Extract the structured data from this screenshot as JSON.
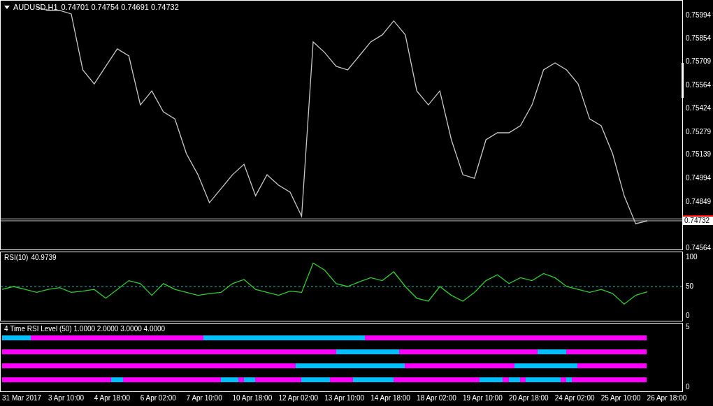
{
  "price_panel": {
    "symbol": "AUDUSD,H1",
    "quote": "0.74701 0.74754 0.74691 0.74732",
    "bid_label": "0.74732",
    "chart_data": {
      "type": "line",
      "ylim": [
        0.74556,
        0.76084
      ],
      "categories": [
        null,
        null,
        null,
        null,
        null,
        null,
        null,
        null,
        null,
        null,
        null,
        null,
        null,
        null,
        null,
        null,
        null,
        null,
        null,
        null,
        null,
        null,
        null,
        null,
        null,
        null,
        null,
        null,
        null,
        null,
        null,
        null,
        null,
        null,
        null,
        null,
        null,
        null,
        null,
        null,
        null,
        null,
        null,
        null,
        null,
        null,
        null,
        null,
        null,
        null,
        null,
        null,
        null,
        null,
        null,
        null,
        null
      ],
      "series": [
        {
          "color": "#c8c8c8",
          "values": [
            null,
            null,
            null,
            0.76045,
            0.76024,
            0.76024,
            0.76003,
            0.75659,
            0.75573,
            0.75681,
            0.75788,
            0.75745,
            0.75444,
            0.7553,
            0.75401,
            0.75358,
            0.75144,
            0.75015,
            0.74843,
            0.74929,
            0.75015,
            0.75079,
            0.74886,
            0.75015,
            0.74951,
            0.74908,
            0.7476,
            0.75831,
            0.75766,
            0.75681,
            0.75659,
            0.75745,
            0.75831,
            0.75874,
            0.7596,
            0.75874,
            0.7553,
            0.75444,
            0.7553,
            0.7523,
            0.75015,
            0.74993,
            0.7523,
            0.75273,
            0.75273,
            0.75316,
            0.75444,
            0.75659,
            0.75702,
            0.75659,
            0.75573,
            0.75358,
            0.75316,
            0.75144,
            0.74886,
            0.74714,
            0.74732
          ]
        }
      ],
      "yticks": [
        {
          "value": 0.75994,
          "label": "0.75994"
        },
        {
          "value": 0.75854,
          "label": "0.75854"
        },
        {
          "value": 0.75709,
          "label": "0.75709"
        },
        {
          "value": 0.75564,
          "label": "0.75564"
        },
        {
          "value": 0.75424,
          "label": "0.75424"
        },
        {
          "value": 0.75279,
          "label": "0.75279"
        },
        {
          "value": 0.75139,
          "label": "0.75139"
        },
        {
          "value": 0.74994,
          "label": "0.74994"
        },
        {
          "value": 0.74849,
          "label": "0.74849"
        },
        {
          "value": 0.74564,
          "label": "0.74564"
        }
      ],
      "ref_lines": [
        {
          "axis": "y",
          "value": 0.74744,
          "color": "#c0c0c0"
        },
        {
          "axis": "y",
          "value": 0.74732,
          "color": "#c0c0c0"
        }
      ]
    }
  },
  "rsi_panel": {
    "title": "RSI(10)",
    "reading": "40.9739",
    "chart_data": {
      "type": "line",
      "ylim": [
        -8.3,
        108.3
      ],
      "categories": [
        null,
        null,
        null,
        null,
        null,
        null,
        null,
        null,
        null,
        null,
        null,
        null,
        null,
        null,
        null,
        null,
        null,
        null,
        null,
        null,
        null,
        null,
        null,
        null,
        null,
        null,
        null,
        null,
        null,
        null,
        null,
        null,
        null,
        null,
        null,
        null,
        null,
        null,
        null,
        null,
        null,
        null,
        null,
        null,
        null,
        null,
        null,
        null,
        null,
        null,
        null,
        null,
        null,
        null,
        null,
        null,
        null
      ],
      "series": [
        {
          "color": "#32cd32",
          "values": [
            45,
            50,
            45,
            40,
            45,
            48,
            40,
            42,
            45,
            30,
            45,
            60,
            55,
            35,
            55,
            45,
            40,
            35,
            38,
            40,
            55,
            62,
            45,
            40,
            35,
            42,
            40,
            90,
            78,
            55,
            50,
            58,
            65,
            60,
            75,
            50,
            30,
            25,
            50,
            35,
            25,
            40,
            60,
            70,
            55,
            65,
            60,
            72,
            65,
            50,
            45,
            40,
            45,
            38,
            20,
            35,
            41
          ]
        }
      ],
      "yticks": [
        {
          "value": 0,
          "label": "0"
        },
        {
          "value": 50,
          "label": "50"
        },
        {
          "value": 100,
          "label": "100"
        }
      ],
      "ref_lines": [
        {
          "axis": "y",
          "value": 50,
          "color": "#20b2aa"
        }
      ]
    }
  },
  "level_panel": {
    "title": "4 Time RSI Level (50) 1.0000 2.0000 3.0000 4.0000",
    "axis_labels": [
      "5",
      "0"
    ],
    "rows": [
      {
        "cells": [
          {
            "color": "#00bfff"
          },
          {
            "color": "#00bfff"
          },
          {
            "color": "#00bfff"
          },
          {
            "color": "#00bfff"
          },
          {
            "color": "#00bfff"
          },
          {
            "color": "#ff00ff"
          },
          {
            "color": "#ff00ff"
          },
          {
            "color": "#ff00ff"
          },
          {
            "color": "#ff00ff"
          },
          {
            "color": "#ff00ff"
          },
          {
            "color": "#ff00ff"
          },
          {
            "color": "#ff00ff"
          },
          {
            "color": "#ff00ff"
          },
          {
            "color": "#ff00ff"
          },
          {
            "color": "#ff00ff"
          },
          {
            "color": "#ff00ff"
          },
          {
            "color": "#ff00ff"
          },
          {
            "color": "#ff00ff"
          },
          {
            "color": "#ff00ff"
          },
          {
            "color": "#ff00ff"
          },
          {
            "color": "#ff00ff"
          },
          {
            "color": "#ff00ff"
          },
          {
            "color": "#ff00ff"
          },
          {
            "color": "#ff00ff"
          },
          {
            "color": "#ff00ff"
          },
          {
            "color": "#ff00ff"
          },
          {
            "color": "#ff00ff"
          },
          {
            "color": "#ff00ff"
          },
          {
            "color": "#ff00ff"
          },
          {
            "color": "#ff00ff"
          },
          {
            "color": "#ff00ff"
          },
          {
            "color": "#ff00ff"
          },
          {
            "color": "#ff00ff"
          },
          {
            "color": "#ff00ff"
          },
          {
            "color": "#ff00ff"
          },
          {
            "color": "#00bfff"
          },
          {
            "color": "#00bfff"
          },
          {
            "color": "#00bfff"
          },
          {
            "color": "#00bfff"
          },
          {
            "color": "#00bfff"
          },
          {
            "color": "#00bfff"
          },
          {
            "color": "#00bfff"
          },
          {
            "color": "#00bfff"
          },
          {
            "color": "#00bfff"
          },
          {
            "color": "#00bfff"
          },
          {
            "color": "#00bfff"
          },
          {
            "color": "#00bfff"
          },
          {
            "color": "#00bfff"
          },
          {
            "color": "#00bfff"
          },
          {
            "color": "#00bfff"
          },
          {
            "color": "#00bfff"
          },
          {
            "color": "#00bfff"
          },
          {
            "color": "#00bfff"
          },
          {
            "color": "#00bfff"
          },
          {
            "color": "#00bfff"
          },
          {
            "color": "#00bfff"
          },
          {
            "color": "#00bfff"
          },
          {
            "color": "#00bfff"
          },
          {
            "color": "#00bfff"
          },
          {
            "color": "#00bfff"
          },
          {
            "color": "#00bfff"
          },
          {
            "color": "#00bfff"
          },
          {
            "color": "#00bfff"
          },
          {
            "color": "#ff00ff"
          },
          {
            "color": "#ff00ff"
          },
          {
            "color": "#ff00ff"
          },
          {
            "color": "#ff00ff"
          },
          {
            "color": "#ff00ff"
          },
          {
            "color": "#ff00ff"
          },
          {
            "color": "#ff00ff"
          },
          {
            "color": "#ff00ff"
          },
          {
            "color": "#ff00ff"
          },
          {
            "color": "#ff00ff"
          },
          {
            "color": "#ff00ff"
          },
          {
            "color": "#ff00ff"
          },
          {
            "color": "#ff00ff"
          },
          {
            "color": "#ff00ff"
          },
          {
            "color": "#ff00ff"
          },
          {
            "color": "#ff00ff"
          },
          {
            "color": "#ff00ff"
          },
          {
            "color": "#ff00ff"
          },
          {
            "color": "#ff00ff"
          },
          {
            "color": "#ff00ff"
          },
          {
            "color": "#ff00ff"
          },
          {
            "color": "#ff00ff"
          },
          {
            "color": "#ff00ff"
          },
          {
            "color": "#ff00ff"
          },
          {
            "color": "#ff00ff"
          },
          {
            "color": "#ff00ff"
          },
          {
            "color": "#ff00ff"
          },
          {
            "color": "#ff00ff"
          },
          {
            "color": "#ff00ff"
          },
          {
            "color": "#ff00ff"
          },
          {
            "color": "#ff00ff"
          },
          {
            "color": "#ff00ff"
          },
          {
            "color": "#ff00ff"
          },
          {
            "color": "#ff00ff"
          },
          {
            "color": "#ff00ff"
          },
          {
            "color": "#ff00ff"
          },
          {
            "color": "#ff00ff"
          },
          {
            "color": "#ff00ff"
          },
          {
            "color": "#ff00ff"
          },
          {
            "color": "#ff00ff"
          },
          {
            "color": "#ff00ff"
          },
          {
            "color": "#ff00ff"
          },
          {
            "color": "#ff00ff"
          },
          {
            "color": "#ff00ff"
          },
          {
            "color": "#ff00ff"
          },
          {
            "color": "#ff00ff"
          },
          {
            "color": "#ff00ff"
          },
          {
            "color": "#ff00ff"
          },
          {
            "color": "#ff00ff"
          }
        ]
      },
      {
        "cells": [
          {
            "color": "#ff00ff"
          },
          {
            "color": "#ff00ff"
          },
          {
            "color": "#ff00ff"
          },
          {
            "color": "#ff00ff"
          },
          {
            "color": "#ff00ff"
          },
          {
            "color": "#ff00ff"
          },
          {
            "color": "#ff00ff"
          },
          {
            "color": "#ff00ff"
          },
          {
            "color": "#ff00ff"
          },
          {
            "color": "#ff00ff"
          },
          {
            "color": "#ff00ff"
          },
          {
            "color": "#ff00ff"
          },
          {
            "color": "#ff00ff"
          },
          {
            "color": "#ff00ff"
          },
          {
            "color": "#ff00ff"
          },
          {
            "color": "#ff00ff"
          },
          {
            "color": "#ff00ff"
          },
          {
            "color": "#ff00ff"
          },
          {
            "color": "#ff00ff"
          },
          {
            "color": "#ff00ff"
          },
          {
            "color": "#ff00ff"
          },
          {
            "color": "#ff00ff"
          },
          {
            "color": "#ff00ff"
          },
          {
            "color": "#ff00ff"
          },
          {
            "color": "#ff00ff"
          },
          {
            "color": "#ff00ff"
          },
          {
            "color": "#ff00ff"
          },
          {
            "color": "#ff00ff"
          },
          {
            "color": "#ff00ff"
          },
          {
            "color": "#ff00ff"
          },
          {
            "color": "#ff00ff"
          },
          {
            "color": "#ff00ff"
          },
          {
            "color": "#ff00ff"
          },
          {
            "color": "#ff00ff"
          },
          {
            "color": "#ff00ff"
          },
          {
            "color": "#ff00ff"
          },
          {
            "color": "#ff00ff"
          },
          {
            "color": "#ff00ff"
          },
          {
            "color": "#ff00ff"
          },
          {
            "color": "#ff00ff"
          },
          {
            "color": "#ff00ff"
          },
          {
            "color": "#ff00ff"
          },
          {
            "color": "#ff00ff"
          },
          {
            "color": "#ff00ff"
          },
          {
            "color": "#ff00ff"
          },
          {
            "color": "#ff00ff"
          },
          {
            "color": "#ff00ff"
          },
          {
            "color": "#ff00ff"
          },
          {
            "color": "#ff00ff"
          },
          {
            "color": "#ff00ff"
          },
          {
            "color": "#ff00ff"
          },
          {
            "color": "#ff00ff"
          },
          {
            "color": "#ff00ff"
          },
          {
            "color": "#ff00ff"
          },
          {
            "color": "#ff00ff"
          },
          {
            "color": "#ff00ff"
          },
          {
            "color": "#ff00ff"
          },
          {
            "color": "#ff00ff"
          },
          {
            "color": "#00bfff"
          },
          {
            "color": "#00bfff"
          },
          {
            "color": "#00bfff"
          },
          {
            "color": "#00bfff"
          },
          {
            "color": "#00bfff"
          },
          {
            "color": "#00bfff"
          },
          {
            "color": "#00bfff"
          },
          {
            "color": "#00bfff"
          },
          {
            "color": "#00bfff"
          },
          {
            "color": "#00bfff"
          },
          {
            "color": "#00bfff"
          },
          {
            "color": "#ff00ff"
          },
          {
            "color": "#ff00ff"
          },
          {
            "color": "#ff00ff"
          },
          {
            "color": "#ff00ff"
          },
          {
            "color": "#ff00ff"
          },
          {
            "color": "#ff00ff"
          },
          {
            "color": "#ff00ff"
          },
          {
            "color": "#ff00ff"
          },
          {
            "color": "#ff00ff"
          },
          {
            "color": "#ff00ff"
          },
          {
            "color": "#ff00ff"
          },
          {
            "color": "#ff00ff"
          },
          {
            "color": "#ff00ff"
          },
          {
            "color": "#ff00ff"
          },
          {
            "color": "#ff00ff"
          },
          {
            "color": "#ff00ff"
          },
          {
            "color": "#ff00ff"
          },
          {
            "color": "#ff00ff"
          },
          {
            "color": "#ff00ff"
          },
          {
            "color": "#ff00ff"
          },
          {
            "color": "#ff00ff"
          },
          {
            "color": "#ff00ff"
          },
          {
            "color": "#ff00ff"
          },
          {
            "color": "#ff00ff"
          },
          {
            "color": "#00bfff"
          },
          {
            "color": "#00bfff"
          },
          {
            "color": "#00bfff"
          },
          {
            "color": "#00bfff"
          },
          {
            "color": "#00bfff"
          },
          {
            "color": "#ff00ff"
          },
          {
            "color": "#ff00ff"
          },
          {
            "color": "#ff00ff"
          },
          {
            "color": "#ff00ff"
          },
          {
            "color": "#ff00ff"
          },
          {
            "color": "#ff00ff"
          },
          {
            "color": "#ff00ff"
          },
          {
            "color": "#ff00ff"
          },
          {
            "color": "#ff00ff"
          },
          {
            "color": "#ff00ff"
          },
          {
            "color": "#ff00ff"
          },
          {
            "color": "#ff00ff"
          },
          {
            "color": "#ff00ff"
          },
          {
            "color": "#ff00ff"
          }
        ]
      },
      {
        "cells": [
          {
            "color": "#ff00ff"
          },
          {
            "color": "#ff00ff"
          },
          {
            "color": "#ff00ff"
          },
          {
            "color": "#ff00ff"
          },
          {
            "color": "#ff00ff"
          },
          {
            "color": "#ff00ff"
          },
          {
            "color": "#ff00ff"
          },
          {
            "color": "#ff00ff"
          },
          {
            "color": "#ff00ff"
          },
          {
            "color": "#ff00ff"
          },
          {
            "color": "#ff00ff"
          },
          {
            "color": "#ff00ff"
          },
          {
            "color": "#ff00ff"
          },
          {
            "color": "#ff00ff"
          },
          {
            "color": "#ff00ff"
          },
          {
            "color": "#ff00ff"
          },
          {
            "color": "#ff00ff"
          },
          {
            "color": "#ff00ff"
          },
          {
            "color": "#ff00ff"
          },
          {
            "color": "#ff00ff"
          },
          {
            "color": "#ff00ff"
          },
          {
            "color": "#ff00ff"
          },
          {
            "color": "#ff00ff"
          },
          {
            "color": "#ff00ff"
          },
          {
            "color": "#ff00ff"
          },
          {
            "color": "#ff00ff"
          },
          {
            "color": "#ff00ff"
          },
          {
            "color": "#ff00ff"
          },
          {
            "color": "#ff00ff"
          },
          {
            "color": "#ff00ff"
          },
          {
            "color": "#ff00ff"
          },
          {
            "color": "#ff00ff"
          },
          {
            "color": "#ff00ff"
          },
          {
            "color": "#ff00ff"
          },
          {
            "color": "#ff00ff"
          },
          {
            "color": "#ff00ff"
          },
          {
            "color": "#ff00ff"
          },
          {
            "color": "#ff00ff"
          },
          {
            "color": "#ff00ff"
          },
          {
            "color": "#ff00ff"
          },
          {
            "color": "#ff00ff"
          },
          {
            "color": "#ff00ff"
          },
          {
            "color": "#ff00ff"
          },
          {
            "color": "#ff00ff"
          },
          {
            "color": "#ff00ff"
          },
          {
            "color": "#ff00ff"
          },
          {
            "color": "#ff00ff"
          },
          {
            "color": "#ff00ff"
          },
          {
            "color": "#ff00ff"
          },
          {
            "color": "#ff00ff"
          },
          {
            "color": "#ff00ff"
          },
          {
            "color": "#00bfff"
          },
          {
            "color": "#00bfff"
          },
          {
            "color": "#00bfff"
          },
          {
            "color": "#00bfff"
          },
          {
            "color": "#00bfff"
          },
          {
            "color": "#00bfff"
          },
          {
            "color": "#00bfff"
          },
          {
            "color": "#00bfff"
          },
          {
            "color": "#00bfff"
          },
          {
            "color": "#00bfff"
          },
          {
            "color": "#00bfff"
          },
          {
            "color": "#00bfff"
          },
          {
            "color": "#00bfff"
          },
          {
            "color": "#00bfff"
          },
          {
            "color": "#00bfff"
          },
          {
            "color": "#00bfff"
          },
          {
            "color": "#00bfff"
          },
          {
            "color": "#00bfff"
          },
          {
            "color": "#00bfff"
          },
          {
            "color": "#ff00ff"
          },
          {
            "color": "#ff00ff"
          },
          {
            "color": "#ff00ff"
          },
          {
            "color": "#ff00ff"
          },
          {
            "color": "#ff00ff"
          },
          {
            "color": "#ff00ff"
          },
          {
            "color": "#ff00ff"
          },
          {
            "color": "#ff00ff"
          },
          {
            "color": "#ff00ff"
          },
          {
            "color": "#ff00ff"
          },
          {
            "color": "#ff00ff"
          },
          {
            "color": "#ff00ff"
          },
          {
            "color": "#ff00ff"
          },
          {
            "color": "#ff00ff"
          },
          {
            "color": "#ff00ff"
          },
          {
            "color": "#ff00ff"
          },
          {
            "color": "#ff00ff"
          },
          {
            "color": "#ff00ff"
          },
          {
            "color": "#ff00ff"
          },
          {
            "color": "#00bfff"
          },
          {
            "color": "#00bfff"
          },
          {
            "color": "#00bfff"
          },
          {
            "color": "#00bfff"
          },
          {
            "color": "#00bfff"
          },
          {
            "color": "#00bfff"
          },
          {
            "color": "#00bfff"
          },
          {
            "color": "#00bfff"
          },
          {
            "color": "#00bfff"
          },
          {
            "color": "#00bfff"
          },
          {
            "color": "#00bfff"
          },
          {
            "color": "#ff00ff"
          },
          {
            "color": "#ff00ff"
          },
          {
            "color": "#ff00ff"
          },
          {
            "color": "#ff00ff"
          },
          {
            "color": "#ff00ff"
          },
          {
            "color": "#ff00ff"
          },
          {
            "color": "#ff00ff"
          },
          {
            "color": "#ff00ff"
          },
          {
            "color": "#ff00ff"
          },
          {
            "color": "#ff00ff"
          },
          {
            "color": "#ff00ff"
          },
          {
            "color": "#ff00ff"
          }
        ]
      },
      {
        "cells": [
          {
            "color": "#ff00ff"
          },
          {
            "color": "#ff00ff"
          },
          {
            "color": "#ff00ff"
          },
          {
            "color": "#ff00ff"
          },
          {
            "color": "#ff00ff"
          },
          {
            "color": "#ff00ff"
          },
          {
            "color": "#ff00ff"
          },
          {
            "color": "#ff00ff"
          },
          {
            "color": "#ff00ff"
          },
          {
            "color": "#ff00ff"
          },
          {
            "color": "#ff00ff"
          },
          {
            "color": "#ff00ff"
          },
          {
            "color": "#ff00ff"
          },
          {
            "color": "#ff00ff"
          },
          {
            "color": "#ff00ff"
          },
          {
            "color": "#ff00ff"
          },
          {
            "color": "#ff00ff"
          },
          {
            "color": "#ff00ff"
          },
          {
            "color": "#ff00ff"
          },
          {
            "color": "#00bfff"
          },
          {
            "color": "#00bfff"
          },
          {
            "color": "#ff00ff"
          },
          {
            "color": "#ff00ff"
          },
          {
            "color": "#ff00ff"
          },
          {
            "color": "#ff00ff"
          },
          {
            "color": "#ff00ff"
          },
          {
            "color": "#ff00ff"
          },
          {
            "color": "#ff00ff"
          },
          {
            "color": "#ff00ff"
          },
          {
            "color": "#ff00ff"
          },
          {
            "color": "#ff00ff"
          },
          {
            "color": "#ff00ff"
          },
          {
            "color": "#ff00ff"
          },
          {
            "color": "#ff00ff"
          },
          {
            "color": "#ff00ff"
          },
          {
            "color": "#ff00ff"
          },
          {
            "color": "#ff00ff"
          },
          {
            "color": "#ff00ff"
          },
          {
            "color": "#00bfff"
          },
          {
            "color": "#00bfff"
          },
          {
            "color": "#00bfff"
          },
          {
            "color": "#ff00ff"
          },
          {
            "color": "#00bfff"
          },
          {
            "color": "#00bfff"
          },
          {
            "color": "#ff00ff"
          },
          {
            "color": "#ff00ff"
          },
          {
            "color": "#ff00ff"
          },
          {
            "color": "#ff00ff"
          },
          {
            "color": "#ff00ff"
          },
          {
            "color": "#ff00ff"
          },
          {
            "color": "#ff00ff"
          },
          {
            "color": "#ff00ff"
          },
          {
            "color": "#00bfff"
          },
          {
            "color": "#00bfff"
          },
          {
            "color": "#00bfff"
          },
          {
            "color": "#00bfff"
          },
          {
            "color": "#00bfff"
          },
          {
            "color": "#ff00ff"
          },
          {
            "color": "#ff00ff"
          },
          {
            "color": "#ff00ff"
          },
          {
            "color": "#ff00ff"
          },
          {
            "color": "#00bfff"
          },
          {
            "color": "#00bfff"
          },
          {
            "color": "#00bfff"
          },
          {
            "color": "#00bfff"
          },
          {
            "color": "#00bfff"
          },
          {
            "color": "#00bfff"
          },
          {
            "color": "#00bfff"
          },
          {
            "color": "#ff00ff"
          },
          {
            "color": "#ff00ff"
          },
          {
            "color": "#ff00ff"
          },
          {
            "color": "#ff00ff"
          },
          {
            "color": "#ff00ff"
          },
          {
            "color": "#ff00ff"
          },
          {
            "color": "#ff00ff"
          },
          {
            "color": "#ff00ff"
          },
          {
            "color": "#ff00ff"
          },
          {
            "color": "#ff00ff"
          },
          {
            "color": "#ff00ff"
          },
          {
            "color": "#ff00ff"
          },
          {
            "color": "#ff00ff"
          },
          {
            "color": "#ff00ff"
          },
          {
            "color": "#ff00ff"
          },
          {
            "color": "#00bfff"
          },
          {
            "color": "#00bfff"
          },
          {
            "color": "#00bfff"
          },
          {
            "color": "#00bfff"
          },
          {
            "color": "#ff00ff"
          },
          {
            "color": "#00bfff"
          },
          {
            "color": "#00bfff"
          },
          {
            "color": "#ff00ff"
          },
          {
            "color": "#00bfff"
          },
          {
            "color": "#00bfff"
          },
          {
            "color": "#00bfff"
          },
          {
            "color": "#00bfff"
          },
          {
            "color": "#00bfff"
          },
          {
            "color": "#00bfff"
          },
          {
            "color": "#ff00ff"
          },
          {
            "color": "#00bfff"
          },
          {
            "color": "#ff00ff"
          },
          {
            "color": "#ff00ff"
          },
          {
            "color": "#ff00ff"
          },
          {
            "color": "#ff00ff"
          },
          {
            "color": "#ff00ff"
          },
          {
            "color": "#ff00ff"
          },
          {
            "color": "#ff00ff"
          },
          {
            "color": "#ff00ff"
          },
          {
            "color": "#ff00ff"
          },
          {
            "color": "#ff00ff"
          },
          {
            "color": "#ff00ff"
          },
          {
            "color": "#ff00ff"
          },
          {
            "color": "#ff00ff"
          }
        ]
      }
    ]
  },
  "time_axis": [
    "31 Mar 2017",
    "3 Apr 10:00",
    "4 Apr 18:00",
    "6 Apr 02:00",
    "7 Apr 10:00",
    "10 Apr 18:00",
    "12 Apr 02:00",
    "13 Apr 10:00",
    "14 Apr 18:00",
    "18 Apr 02:00",
    "19 Apr 10:00",
    "20 Apr 18:00",
    "24 Apr 02:00",
    "25 Apr 10:00",
    "26 Apr 18:00"
  ]
}
